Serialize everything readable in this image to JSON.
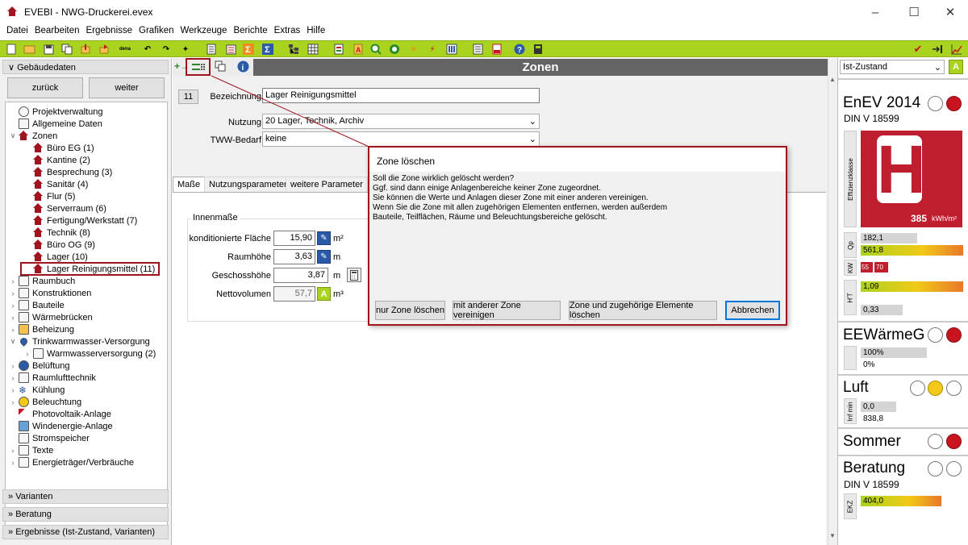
{
  "window": {
    "title": "EVEBI - NWG-Druckerei.evex"
  },
  "menu": [
    "Datei",
    "Bearbeiten",
    "Ergebnisse",
    "Grafiken",
    "Werkzeuge",
    "Berichte",
    "Extras",
    "Hilfe"
  ],
  "toolbar": {
    "dena_label": "dena"
  },
  "left": {
    "header": "Gebäudedaten",
    "back_label": "zurück",
    "next_label": "weiter",
    "tree": [
      {
        "label": "Projektverwaltung",
        "level": 0,
        "icon": "stopwatch-icon"
      },
      {
        "label": "Allgemeine Daten",
        "level": 0,
        "icon": "building-icon"
      },
      {
        "label": "Zonen",
        "level": 0,
        "icon": "house-icon",
        "expanded": true
      },
      {
        "label": "Büro EG (1)",
        "level": 1,
        "icon": "house-icon"
      },
      {
        "label": "Kantine (2)",
        "level": 1,
        "icon": "house-icon"
      },
      {
        "label": "Besprechung (3)",
        "level": 1,
        "icon": "house-icon"
      },
      {
        "label": "Sanitär (4)",
        "level": 1,
        "icon": "house-icon"
      },
      {
        "label": "Flur (5)",
        "level": 1,
        "icon": "house-icon"
      },
      {
        "label": "Serverraum (6)",
        "level": 1,
        "icon": "house-icon"
      },
      {
        "label": "Fertigung/Werkstatt (7)",
        "level": 1,
        "icon": "house-icon"
      },
      {
        "label": "Technik (8)",
        "level": 1,
        "icon": "house-icon"
      },
      {
        "label": "Büro OG (9)",
        "level": 1,
        "icon": "house-icon"
      },
      {
        "label": "Lager (10)",
        "level": 1,
        "icon": "house-icon"
      },
      {
        "label": "Lager Reinigungsmittel (11)",
        "level": 1,
        "icon": "house-icon",
        "selected": true
      },
      {
        "label": "Raumbuch",
        "level": 0,
        "icon": "book-icon",
        "collapsed": true
      },
      {
        "label": "Konstruktionen",
        "level": 0,
        "icon": "wall-icon",
        "collapsed": true
      },
      {
        "label": "Bauteile",
        "level": 0,
        "icon": "window-icon",
        "collapsed": true
      },
      {
        "label": "Wärmebrücken",
        "level": 0,
        "icon": "bridge-icon",
        "collapsed": true
      },
      {
        "label": "Beheizung",
        "level": 0,
        "icon": "heater-icon",
        "collapsed": true
      },
      {
        "label": "Trinkwarmwasser-Versorgung",
        "level": 0,
        "icon": "water-drop-icon",
        "expanded": true
      },
      {
        "label": "Warmwasserversorgung (2)",
        "level": 1,
        "icon": "boiler-icon",
        "collapsed": true
      },
      {
        "label": "Belüftung",
        "level": 0,
        "icon": "fan-icon",
        "collapsed": true
      },
      {
        "label": "Raumlufttechnik",
        "level": 0,
        "icon": "air-unit-icon",
        "collapsed": true
      },
      {
        "label": "Kühlung",
        "level": 0,
        "icon": "snowflake-icon",
        "collapsed": true
      },
      {
        "label": "Beleuchtung",
        "level": 0,
        "icon": "bulb-icon",
        "collapsed": true
      },
      {
        "label": "Photovoltaik-Anlage",
        "level": 0,
        "icon": "solar-icon"
      },
      {
        "label": "Windenergie-Anlage",
        "level": 0,
        "icon": "wind-icon"
      },
      {
        "label": "Stromspeicher",
        "level": 0,
        "icon": "battery-icon"
      },
      {
        "label": "Texte",
        "level": 0,
        "icon": "document-icon",
        "collapsed": true
      },
      {
        "label": "Energieträger/Verbräuche",
        "level": 0,
        "icon": "plug-icon",
        "collapsed": true
      }
    ],
    "sections": [
      "Varianten",
      "Beratung",
      "Ergebnisse (Ist-Zustand, Varianten)"
    ]
  },
  "center": {
    "title": "Zonen",
    "zone_number": "11",
    "bezeichnung_label": "Bezeichnung",
    "bezeichnung_value": "Lager Reinigungsmittel",
    "nutzung_label": "Nutzung",
    "nutzung_value": "20 Lager, Technik, Archiv",
    "tww_label": "TWW-Bedarf",
    "tww_value": "keine",
    "tabs": [
      "Maße",
      "Nutzungsparameter",
      "weitere Parameter"
    ],
    "group_label": "Innenmaße",
    "fields": [
      {
        "label": "konditionierte Fläche",
        "value": "15,90",
        "unit": "m²"
      },
      {
        "label": "Raumhöhe",
        "value": "3,63",
        "unit": "m"
      },
      {
        "label": "Geschosshöhe",
        "value": "3,87",
        "unit": "m"
      },
      {
        "label": "Nettovolumen",
        "value": "57,7",
        "unit": "m³"
      }
    ]
  },
  "dialog": {
    "title": "Zone löschen",
    "message": [
      "Soll die Zone wirklich gelöscht werden?",
      "Ggf. sind dann einige Anlagenbereiche keiner Zone zugeordnet.",
      "Sie können die Werte und Anlagen dieser Zone mit einer anderen vereinigen.",
      "Wenn Sie die Zone mit allen zugehörigen Elementen entfernen, werden außerdem",
      "Bauteile, Teilflächen, Räume und Beleuchtungsbereiche gelöscht."
    ],
    "buttons": [
      "nur Zone löschen",
      "mit anderer Zone vereinigen",
      "Zone und zugehörige Elemente löschen",
      "Abbrechen"
    ]
  },
  "right": {
    "state_value": "Ist-Zustand",
    "enev": {
      "title": "EnEV 2014",
      "subtitle": "DIN V 18599",
      "class_label": "Effizienzklasse",
      "class_letter": "H",
      "value": "385",
      "unit": "kWh/m²",
      "qp_label": "Qp",
      "qp_values": [
        "182,1",
        "561,8"
      ],
      "kw_label": "KW",
      "kw_values": [
        "55",
        "70"
      ],
      "ht_label": "H'T",
      "ht_values": [
        "1,09",
        "0,33"
      ]
    },
    "eew": {
      "title": "EEWärmeG",
      "values": [
        "100%",
        "0%"
      ]
    },
    "luft": {
      "title": "Luft",
      "label": "Inf min",
      "values": [
        "0,0",
        "838,8"
      ]
    },
    "sommer": {
      "title": "Sommer"
    },
    "beratung": {
      "title": "Beratung",
      "subtitle": "DIN V 18599",
      "label": "EKZ",
      "value": "404,0"
    },
    "colors": {
      "accent_green": "#a9d31e",
      "brand_red": "#a0141e",
      "traffic_red": "#c8141e",
      "traffic_yellow": "#f2c918"
    }
  }
}
